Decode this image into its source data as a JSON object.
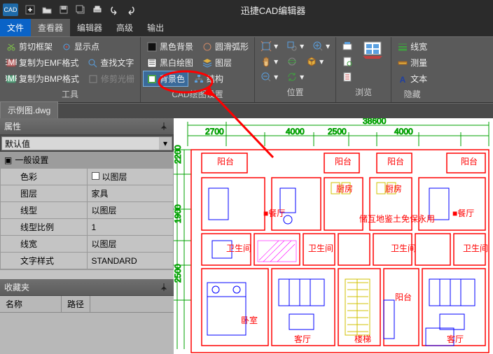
{
  "app": {
    "title": "迅捷CAD编辑器",
    "logo": "CAD"
  },
  "tabs": {
    "file": "文件",
    "viewer": "查看器",
    "editor": "编辑器",
    "advanced": "高级",
    "output": "输出"
  },
  "ribbon": {
    "tools": {
      "clipframe": "剪切框架",
      "copyemf": "复制为EMF格式",
      "copybmp": "复制为BMP格式",
      "showpoint": "显示点",
      "searchtext": "查找文字",
      "trimring": "修剪光栅",
      "label": "工具"
    },
    "cadset": {
      "blackbg": "黑色背景",
      "bwdraw": "黑白绘图",
      "bgcolor": "背景色",
      "smootharc": "圆滑弧形",
      "layer": "图层",
      "structure": "结构",
      "label": "CAD绘图设置"
    },
    "position": {
      "label": "位置"
    },
    "browse": {
      "label": "浏览"
    },
    "hide": {
      "linewidth": "线宽",
      "measure": "测量",
      "text": "文本",
      "label": "隐藏"
    }
  },
  "doc": {
    "name": "示例图.dwg"
  },
  "prop": {
    "title": "属性",
    "defaultval": "默认值",
    "section": "一般设置",
    "rows": [
      {
        "k": "色彩",
        "v": "以图层"
      },
      {
        "k": "图层",
        "v": "家具"
      },
      {
        "k": "线型",
        "v": "以图层"
      },
      {
        "k": "线型比例",
        "v": "1"
      },
      {
        "k": "线宽",
        "v": "以图层"
      },
      {
        "k": "文字样式",
        "v": "STANDARD"
      }
    ]
  },
  "fav": {
    "title": "收藏夹",
    "col1": "名称",
    "col2": "路径"
  }
}
